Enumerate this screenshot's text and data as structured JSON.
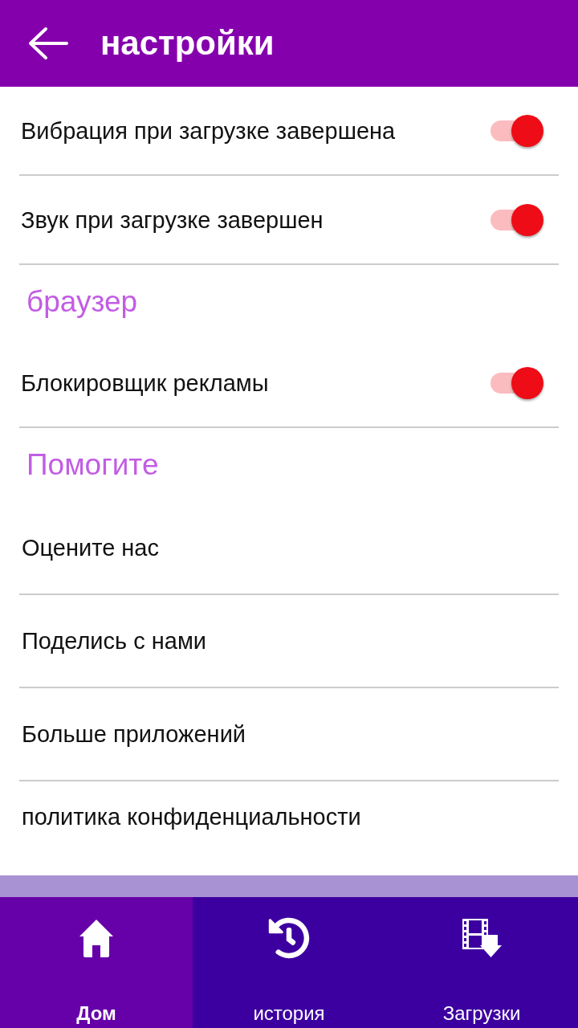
{
  "app_bar": {
    "title": "настройки"
  },
  "settings": [
    {
      "kind": "toggle",
      "label": "Вибрация при загрузке завершена",
      "on": true
    },
    {
      "kind": "toggle",
      "label": "Звук при загрузке завершен",
      "on": true
    },
    {
      "kind": "section",
      "label": "браузер"
    },
    {
      "kind": "toggle",
      "label": "Блокировщик рекламы",
      "on": true
    },
    {
      "kind": "section",
      "label": "Помогите"
    },
    {
      "kind": "link",
      "label": "Оцените нас"
    },
    {
      "kind": "link",
      "label": "Поделись с нами"
    },
    {
      "kind": "link",
      "label": "Больше приложений"
    },
    {
      "kind": "link",
      "label": "политика конфиденциальности"
    }
  ],
  "bottom_nav": [
    {
      "label": "Дом",
      "selected": true
    },
    {
      "label": "история",
      "selected": false
    },
    {
      "label": "Загрузки",
      "selected": false
    }
  ]
}
